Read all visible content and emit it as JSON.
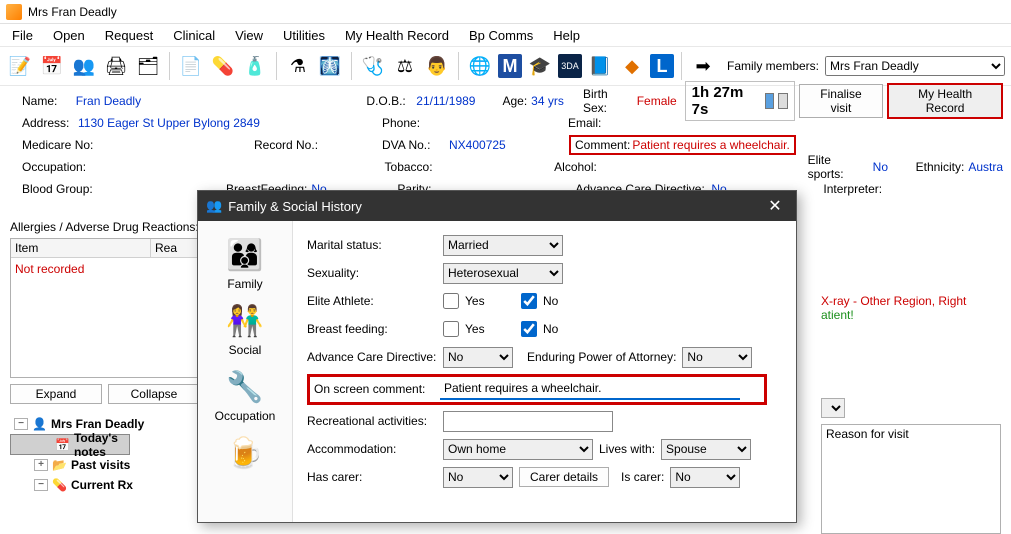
{
  "window_title": "Mrs Fran Deadly",
  "menu": [
    "File",
    "Open",
    "Request",
    "Clinical",
    "View",
    "Utilities",
    "My Health Record",
    "Bp Comms",
    "Help"
  ],
  "family_members_label": "Family members:",
  "family_member_selected": "Mrs Fran Deadly",
  "header": {
    "name_label": "Name:",
    "name": "Fran Deadly",
    "dob_label": "D.O.B.:",
    "dob": "21/11/1989",
    "age_label": "Age:",
    "age": "34 yrs",
    "birthsex_label": "Birth Sex:",
    "birthsex": "Female",
    "timer": "1h 27m  7s",
    "finalise": "Finalise visit",
    "mhr": "My Health Record",
    "address_label": "Address:",
    "address": "1130 Eager St  Upper Bylong  2849",
    "phone_label": "Phone:",
    "email_label": "Email:",
    "medicare_label": "Medicare No:",
    "recordno_label": "Record No.:",
    "dva_label": "DVA No.:",
    "dva": "NX400725",
    "comment_label": "Comment:",
    "comment_value": "Patient requires a wheelchair.",
    "occupation_label": "Occupation:",
    "tobacco_label": "Tobacco:",
    "alcohol_label": "Alcohol:",
    "elitesports_label": "Elite sports:",
    "elitesports": "No",
    "ethnicity_label": "Ethnicity:",
    "ethnicity": "Austra",
    "bloodgroup_label": "Blood Group:",
    "breastfeeding_label": "BreastFeeding:",
    "breastfeeding": "No",
    "parity_label": "Parity:",
    "acd_label": "Advance Care Directive:",
    "acd": "No",
    "interpreter_label": "Interpreter:"
  },
  "allergies_label": "Allergies / Adverse Drug Reactions:",
  "list_cols": {
    "item": "Item",
    "reaction": "Rea"
  },
  "not_recorded": "Not recorded",
  "expand": "Expand",
  "collapse": "Collapse",
  "tree": {
    "patient": "Mrs Fran Deadly",
    "today": "Today's notes",
    "past": "Past visits",
    "rx": "Current Rx"
  },
  "right": {
    "note1": "X-ray - Other Region, Right",
    "note2": "atient!",
    "reason_label": "Reason for visit"
  },
  "modal": {
    "title": "Family & Social History",
    "side": [
      "Family",
      "Social",
      "Occupation",
      ""
    ],
    "marital_label": "Marital status:",
    "marital": "Married",
    "sexuality_label": "Sexuality:",
    "sexuality": "Heterosexual",
    "elite_label": "Elite Athlete:",
    "yes": "Yes",
    "no": "No",
    "bf_label": "Breast feeding:",
    "acd_label": "Advance Care Directive:",
    "acd_value": "No",
    "epa_label": "Enduring Power of Attorney:",
    "epa_value": "No",
    "onscreen_label": "On screen comment:",
    "onscreen_value": "Patient requires a wheelchair.",
    "rec_label": "Recreational activities:",
    "accom_label": "Accommodation:",
    "accom_value": "Own home",
    "lives_label": "Lives with:",
    "lives_value": "Spouse",
    "hascarer_label": "Has  carer:",
    "hascarer_value": "No",
    "carer_details": "Carer details",
    "iscarer_label": "Is carer:",
    "iscarer_value": "No"
  }
}
